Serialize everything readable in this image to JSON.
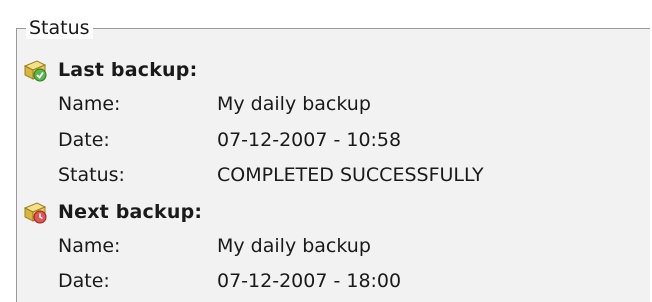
{
  "status_group": {
    "legend": "Status",
    "last_backup": {
      "title": "Last backup:",
      "icon": "backup-drive-ok-icon",
      "name_label": "Name:",
      "name_value": "My daily backup",
      "date_label": "Date:",
      "date_value": "07-12-2007 - 10:58",
      "status_label": "Status:",
      "status_value": "COMPLETED SUCCESSFULLY"
    },
    "next_backup": {
      "title": "Next backup:",
      "icon": "backup-drive-scheduled-icon",
      "name_label": "Name:",
      "name_value": "My daily backup",
      "date_label": "Date:",
      "date_value": "07-12-2007 - 18:00"
    }
  }
}
